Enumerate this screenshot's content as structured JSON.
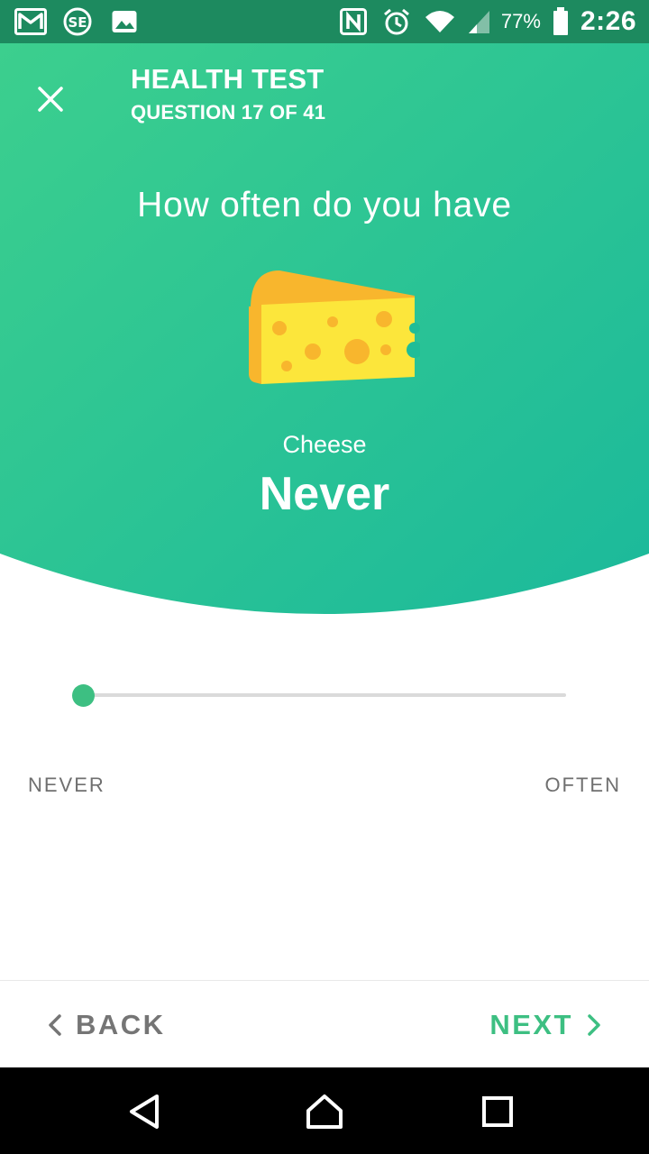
{
  "status_bar": {
    "left_icons": [
      "gmail-icon",
      "stack-exchange-icon",
      "image-icon"
    ],
    "right_icons": [
      "nfc-icon",
      "alarm-icon",
      "wifi-icon",
      "signal-icon",
      "battery-icon"
    ],
    "battery": "77%",
    "time": "2:26"
  },
  "header": {
    "title": "HEALTH TEST",
    "subtitle": "QUESTION 17 OF 41",
    "close_icon": "close-icon"
  },
  "question": {
    "prompt": "How often do you have",
    "item_icon": "cheese-icon",
    "item": "Cheese",
    "answer": "Never"
  },
  "slider": {
    "value": 0,
    "min_label": "NEVER",
    "max_label": "OFTEN"
  },
  "footer": {
    "back_label": "BACK",
    "back_icon": "chevron-left-icon",
    "next_label": "NEXT",
    "next_icon": "chevron-right-icon"
  },
  "colors": {
    "gradient_start": "#3ccf8e",
    "gradient_end": "#1bb99b",
    "accent": "#3dbf82",
    "status_bar": "#1d8a5f",
    "muted_text": "#757575",
    "cheese_body": "#fce63b",
    "cheese_rind": "#f8b62d"
  },
  "nav_bar": {
    "icons": [
      "back-triangle-icon",
      "home-icon",
      "recents-square-icon"
    ]
  }
}
